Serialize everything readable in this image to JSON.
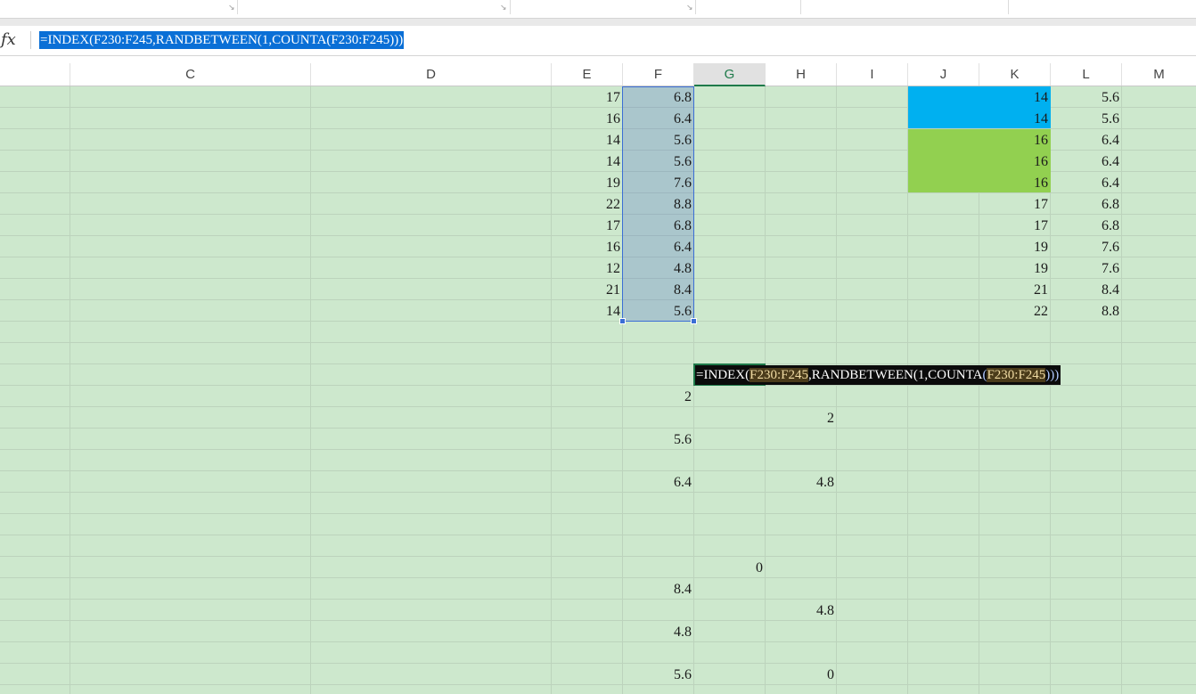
{
  "formula_bar": {
    "fx_label": "fx",
    "formula": "=INDEX(F230:F245,RANDBETWEEN(1,COUNTA(F230:F245)))"
  },
  "columns": [
    {
      "name": "C"
    },
    {
      "name": "D"
    },
    {
      "name": "E"
    },
    {
      "name": "F"
    },
    {
      "name": "G",
      "selected": true
    },
    {
      "name": "H"
    },
    {
      "name": "I"
    },
    {
      "name": "J"
    },
    {
      "name": "K"
    },
    {
      "name": "L"
    },
    {
      "name": "M"
    }
  ],
  "data_e": [
    "17",
    "16",
    "14",
    "14",
    "19",
    "22",
    "17",
    "16",
    "12",
    "21",
    "14"
  ],
  "data_f": [
    "6.8",
    "6.4",
    "5.6",
    "5.6",
    "7.6",
    "8.8",
    "6.8",
    "6.4",
    "4.8",
    "8.4",
    "5.6"
  ],
  "data_k": [
    "14",
    "14",
    "16",
    "16",
    "16",
    "17",
    "17",
    "19",
    "19",
    "21",
    "22"
  ],
  "data_l": [
    "5.6",
    "5.6",
    "6.4",
    "6.4",
    "6.4",
    "6.8",
    "6.8",
    "7.6",
    "7.6",
    "8.4",
    "8.8"
  ],
  "cell_edit": {
    "prefix": "=INDEX(",
    "ref1": "F230:F245",
    "mid": ",RANDBETWEEN(1,COUNTA",
    "open": "(",
    "ref2": "F230:F245",
    "close": ")))"
  },
  "lower_cells": {
    "f_2": "2",
    "h_2": "2",
    "f_56a": "5.6",
    "f_64": "6.4",
    "h_48a": "4.8",
    "g_0": "0",
    "f_84": "8.4",
    "h_48b": "4.8",
    "f_48": "4.8",
    "f_56b": "5.6",
    "h_0": "0"
  },
  "colors": {
    "sheet_bg": "#cde8cd",
    "selection_blue": "#3b6ed5",
    "highlight_cyan": "#00b0f0",
    "highlight_green": "#92d050",
    "active_green": "#1f7a4a"
  }
}
